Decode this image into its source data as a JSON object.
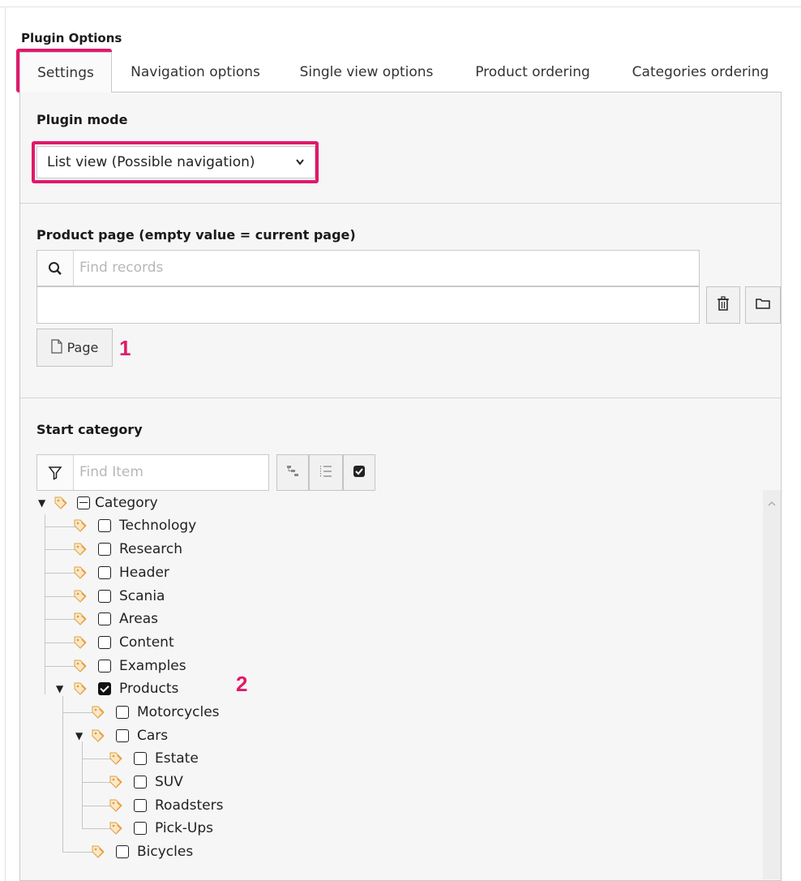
{
  "plugin_options_title": "Plugin Options",
  "tabs": [
    {
      "label": "Settings",
      "active": true
    },
    {
      "label": "Navigation options",
      "active": false
    },
    {
      "label": "Single view options",
      "active": false
    },
    {
      "label": "Product ordering",
      "active": false
    },
    {
      "label": "Categories ordering",
      "active": false
    }
  ],
  "plugin_mode": {
    "label": "Plugin mode",
    "selected": "List view (Possible navigation)"
  },
  "product_page": {
    "label": "Product page (empty value = current page)",
    "search_placeholder": "Find records",
    "value": "",
    "page_button": "Page",
    "annotation": "1"
  },
  "start_category": {
    "label": "Start category",
    "filter_placeholder": "Find Item",
    "annotation": "2",
    "tree": [
      {
        "label": "Category",
        "level": 0,
        "state": "partial",
        "expanded": true
      },
      {
        "label": "Technology",
        "level": 1,
        "state": "unchecked"
      },
      {
        "label": "Research",
        "level": 1,
        "state": "unchecked"
      },
      {
        "label": "Header",
        "level": 1,
        "state": "unchecked"
      },
      {
        "label": "Scania",
        "level": 1,
        "state": "unchecked"
      },
      {
        "label": "Areas",
        "level": 1,
        "state": "unchecked"
      },
      {
        "label": "Content",
        "level": 1,
        "state": "unchecked"
      },
      {
        "label": "Examples",
        "level": 1,
        "state": "unchecked"
      },
      {
        "label": "Products",
        "level": 1,
        "state": "checked",
        "expanded": true
      },
      {
        "label": "Motorcycles",
        "level": 2,
        "state": "unchecked"
      },
      {
        "label": "Cars",
        "level": 2,
        "state": "unchecked",
        "expanded": true
      },
      {
        "label": "Estate",
        "level": 3,
        "state": "unchecked"
      },
      {
        "label": "SUV",
        "level": 3,
        "state": "unchecked"
      },
      {
        "label": "Roadsters",
        "level": 3,
        "state": "unchecked"
      },
      {
        "label": "Pick-Ups",
        "level": 3,
        "state": "unchecked"
      },
      {
        "label": "Bicycles",
        "level": 2,
        "state": "unchecked"
      }
    ]
  },
  "colors": {
    "highlight": "#e0196b",
    "tag_icon": "#f39c41"
  },
  "icons": [
    "search-icon",
    "trash-icon",
    "folder-icon",
    "page-icon",
    "filter-icon",
    "tree-expand-icon",
    "tree-list-icon",
    "check-all-icon",
    "tag-icon",
    "scroll-up-icon"
  ]
}
